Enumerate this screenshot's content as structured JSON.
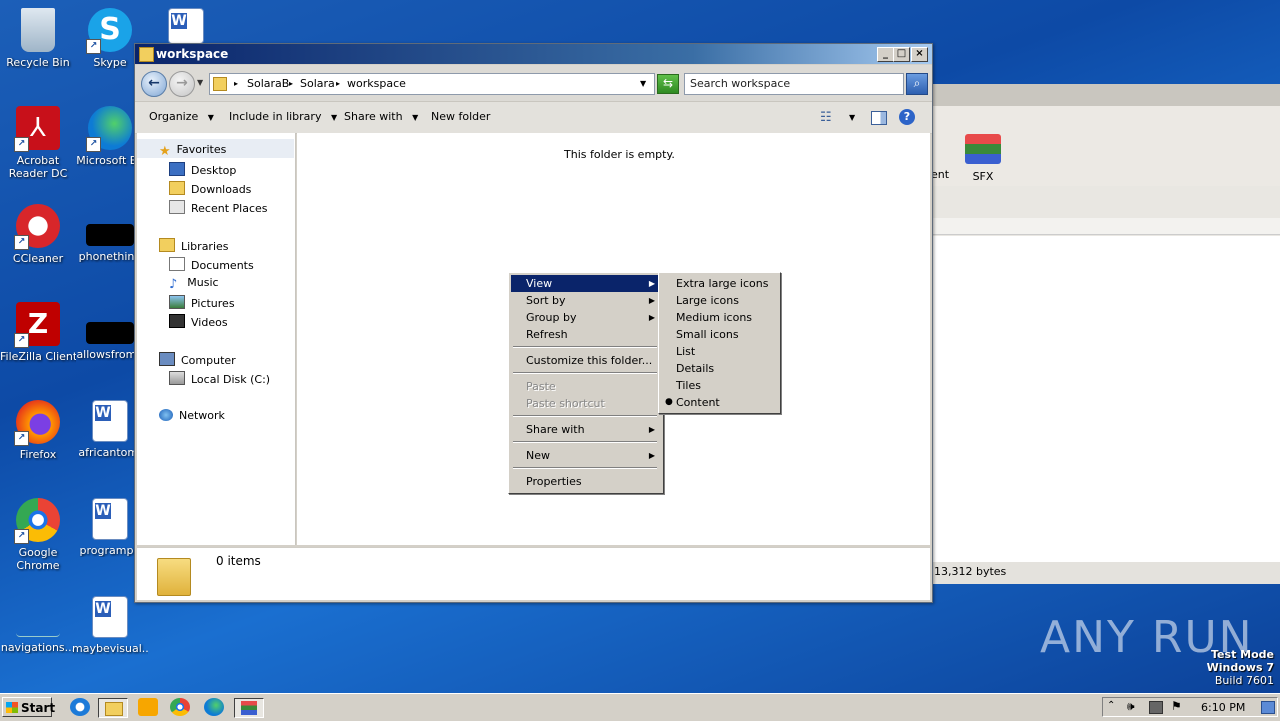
{
  "desktop": {
    "icons": [
      {
        "label": "Recycle Bin"
      },
      {
        "label": "Skype"
      },
      {
        "label": "Acrobat Reader DC"
      },
      {
        "label": "Microsoft Ed"
      },
      {
        "label": "CCleaner"
      },
      {
        "label": "phonething"
      },
      {
        "label": "FileZilla Client"
      },
      {
        "label": "allowsfrom.:"
      },
      {
        "label": "Firefox"
      },
      {
        "label": "africantom."
      },
      {
        "label": "Google Chrome"
      },
      {
        "label": "programph"
      },
      {
        "label": "navigations..."
      },
      {
        "label": "maybevisual..."
      }
    ]
  },
  "bg_window": {
    "toolbar_labels": [
      "ent",
      "SFX"
    ],
    "status": "13,312 bytes"
  },
  "explorer": {
    "title": "workspace",
    "breadcrumb": [
      "SolaraB",
      "Solara",
      "workspace"
    ],
    "search_placeholder": "Search workspace",
    "toolbar": {
      "organize": "Organize",
      "include": "Include in library",
      "share": "Share with",
      "new_folder": "New folder"
    },
    "nav": {
      "favorites": "Favorites",
      "desktop": "Desktop",
      "downloads": "Downloads",
      "recent": "Recent Places",
      "libraries": "Libraries",
      "documents": "Documents",
      "music": "Music",
      "pictures": "Pictures",
      "videos": "Videos",
      "computer": "Computer",
      "local_disk": "Local Disk (C:)",
      "network": "Network"
    },
    "empty_message": "This folder is empty.",
    "status_items": "0 items"
  },
  "context_menu": {
    "view": "View",
    "sort_by": "Sort by",
    "group_by": "Group by",
    "refresh": "Refresh",
    "customize": "Customize this folder...",
    "paste": "Paste",
    "paste_shortcut": "Paste shortcut",
    "share_with": "Share with",
    "new": "New",
    "properties": "Properties"
  },
  "view_submenu": {
    "extra_large": "Extra large icons",
    "large": "Large icons",
    "medium": "Medium icons",
    "small": "Small icons",
    "list": "List",
    "details": "Details",
    "tiles": "Tiles",
    "content": "Content",
    "selected": "Content"
  },
  "watermark": {
    "brand": "ANY RUN",
    "line1": "Test Mode",
    "line2": "Windows 7",
    "line3": "Build 7601"
  },
  "taskbar": {
    "start": "Start",
    "clock": "6:10 PM"
  }
}
